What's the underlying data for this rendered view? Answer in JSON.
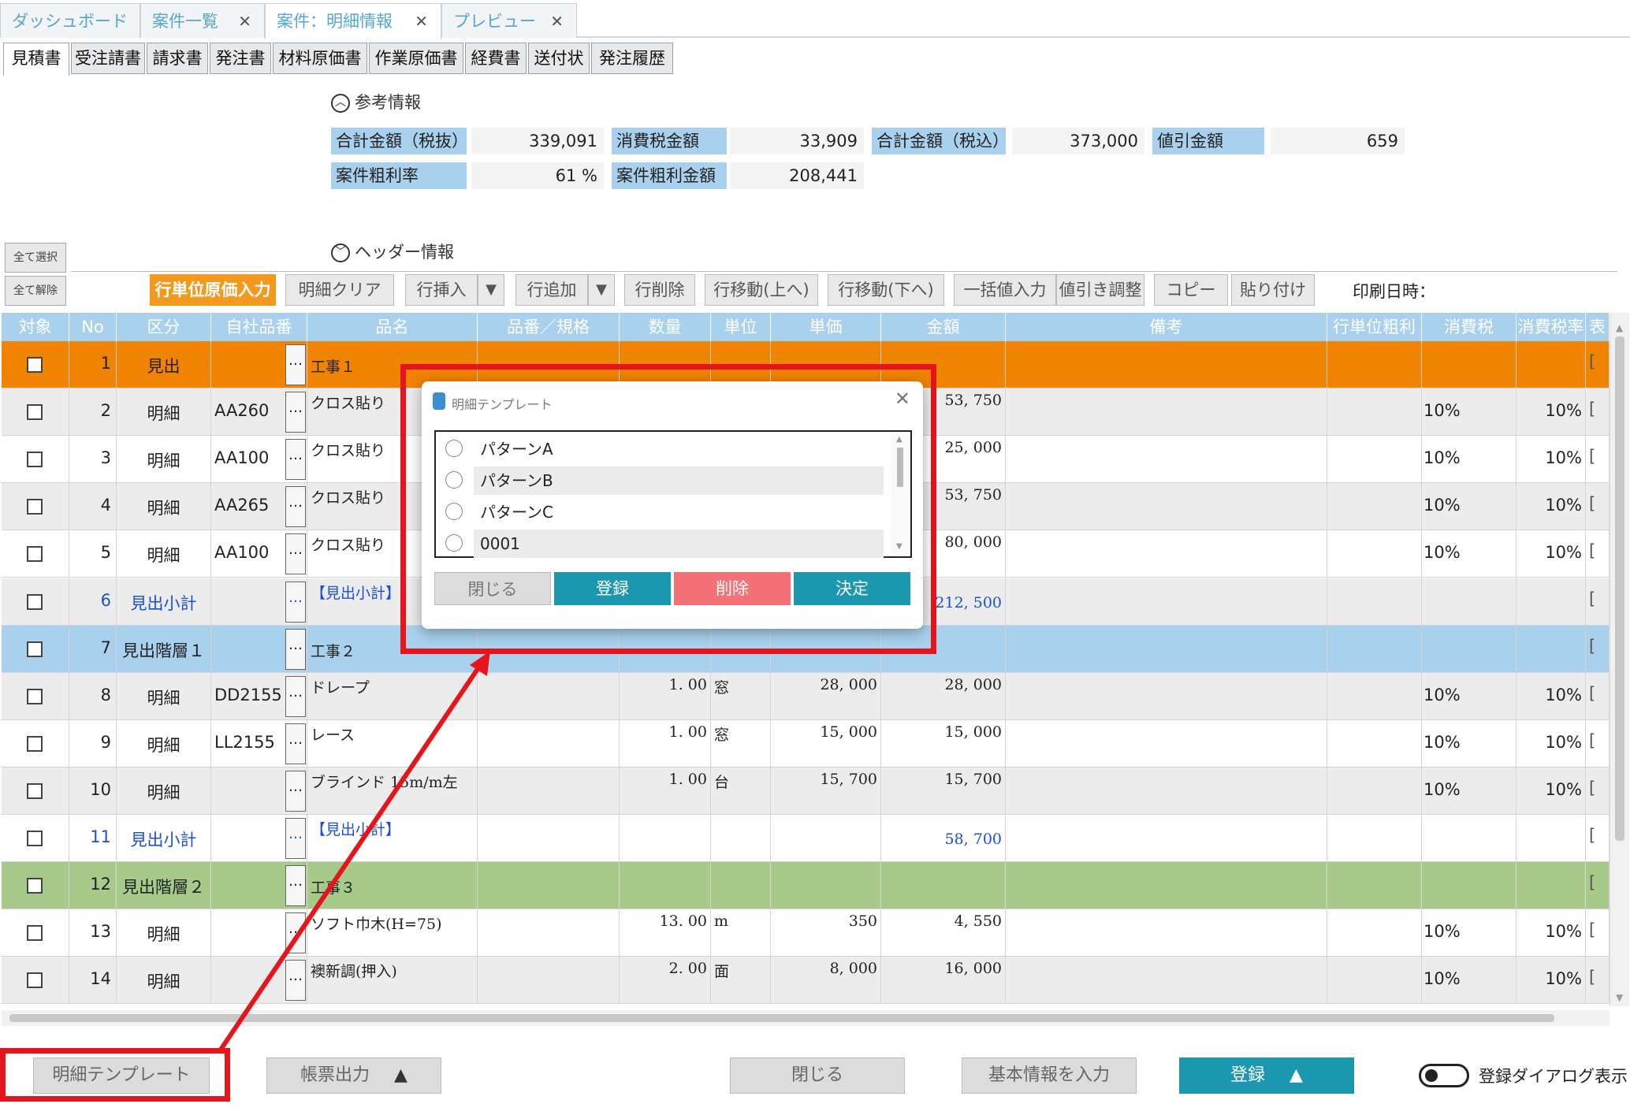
{
  "main_tabs": [
    {
      "label": "ダッシュボード",
      "closable": false
    },
    {
      "label": "案件一覧",
      "closable": true
    },
    {
      "label": "案件：明細情報",
      "closable": true
    },
    {
      "label": "プレビュー",
      "closable": true
    }
  ],
  "close_glyph": "✕",
  "doc_tabs": [
    "見積書",
    "受注請書",
    "請求書",
    "発注書",
    "材料原価書",
    "作業原価書",
    "経費書",
    "送付状",
    "発注履歴"
  ],
  "reference": {
    "title": "参考情報",
    "labels": [
      "合計金額（税抜）",
      "消費税金額",
      "合計金額（税込）",
      "値引金額",
      "案件粗利率",
      "案件粗利金額"
    ],
    "values": [
      "339,091",
      "33,909",
      "373,000",
      "659",
      "61 %",
      "208,441"
    ]
  },
  "header_section": {
    "title": "ヘッダー情報"
  },
  "side_buttons": {
    "select_all": "全て選択",
    "deselect_all": "全て解除"
  },
  "toolbar": {
    "cost_input": "行単位原価入力",
    "clear": "明細クリア",
    "insert": "行挿入",
    "add": "行追加",
    "delete": "行削除",
    "move_up": "行移動(上へ)",
    "move_down": "行移動(下へ)",
    "bulk": "一括値入力",
    "discount": "値引き調整",
    "copy": "コピー",
    "paste": "貼り付け",
    "print_date": "印刷日時："
  },
  "grid": {
    "columns": [
      "対象",
      "No",
      "区分",
      "自社品番",
      "品名",
      "品番／規格",
      "数量",
      "単位",
      "単価",
      "金額",
      "備考",
      "行単位粗利",
      "消費税",
      "消費税率",
      "表"
    ],
    "rows": [
      {
        "no": "1",
        "kubun": "見出",
        "code": "",
        "name": "工事１",
        "qty": "",
        "unit": "",
        "price": "",
        "amount": "",
        "tax": "",
        "rate": "",
        "style": "orange"
      },
      {
        "no": "2",
        "kubun": "明細",
        "code": "AA260",
        "name": "クロス貼り",
        "qty": "",
        "unit": "",
        "price": "",
        "amount": "53, 750",
        "tax": "10%",
        "rate": "10%",
        "style": "grey"
      },
      {
        "no": "3",
        "kubun": "明細",
        "code": "AA100",
        "name": "クロス貼り",
        "qty": "",
        "unit": "",
        "price": "",
        "amount": "25, 000",
        "tax": "10%",
        "rate": "10%",
        "style": "white"
      },
      {
        "no": "4",
        "kubun": "明細",
        "code": "AA265",
        "name": "クロス貼り",
        "qty": "",
        "unit": "",
        "price": "",
        "amount": "53, 750",
        "tax": "10%",
        "rate": "10%",
        "style": "grey"
      },
      {
        "no": "5",
        "kubun": "明細",
        "code": "AA100",
        "name": "クロス貼り",
        "qty": "",
        "unit": "",
        "price": "",
        "amount": "80, 000",
        "tax": "10%",
        "rate": "10%",
        "style": "white"
      },
      {
        "no": "6",
        "kubun": "見出小計",
        "code": "",
        "name": "【見出小計】",
        "qty": "",
        "unit": "",
        "price": "",
        "amount": "212, 500",
        "tax": "",
        "rate": "",
        "style": "grey",
        "link": true
      },
      {
        "no": "7",
        "kubun": "見出階層１",
        "code": "",
        "name": "工事２",
        "qty": "",
        "unit": "",
        "price": "",
        "amount": "",
        "tax": "",
        "rate": "",
        "style": "blue"
      },
      {
        "no": "8",
        "kubun": "明細",
        "code": "DD2155",
        "name": "ドレープ",
        "qty": "1. 00",
        "unit": "窓",
        "price": "28, 000",
        "amount": "28, 000",
        "tax": "10%",
        "rate": "10%",
        "style": "grey"
      },
      {
        "no": "9",
        "kubun": "明細",
        "code": "LL2155",
        "name": "レース",
        "qty": "1. 00",
        "unit": "窓",
        "price": "15, 000",
        "amount": "15, 000",
        "tax": "10%",
        "rate": "10%",
        "style": "white"
      },
      {
        "no": "10",
        "kubun": "明細",
        "code": "",
        "name": "ブラインド 15m/m左",
        "qty": "1. 00",
        "unit": "台",
        "price": "15, 700",
        "amount": "15, 700",
        "tax": "10%",
        "rate": "10%",
        "style": "grey"
      },
      {
        "no": "11",
        "kubun": "見出小計",
        "code": "",
        "name": "【見出小計】",
        "qty": "",
        "unit": "",
        "price": "",
        "amount": "58, 700",
        "tax": "",
        "rate": "",
        "style": "white",
        "link": true
      },
      {
        "no": "12",
        "kubun": "見出階層２",
        "code": "",
        "name": "工事３",
        "qty": "",
        "unit": "",
        "price": "",
        "amount": "",
        "tax": "",
        "rate": "",
        "style": "green"
      },
      {
        "no": "13",
        "kubun": "明細",
        "code": "",
        "name": "ソフト巾木(H=75)",
        "qty": "13. 00",
        "unit": "m",
        "price": "350",
        "amount": "4, 550",
        "tax": "10%",
        "rate": "10%",
        "style": "white"
      },
      {
        "no": "14",
        "kubun": "明細",
        "code": "",
        "name": "襖新調(押入)",
        "qty": "2. 00",
        "unit": "面",
        "price": "8, 000",
        "amount": "16, 000",
        "tax": "10%",
        "rate": "10%",
        "style": "grey"
      }
    ]
  },
  "bottom": {
    "template": "明細テンプレート",
    "report": "帳票出力",
    "close": "閉じる",
    "basic": "基本情報を入力",
    "register": "登録",
    "toggle_label": "登録ダイアログ表示"
  },
  "dialog": {
    "title": "明細テンプレート",
    "options": [
      "パターンA",
      "パターンB",
      "パターンC",
      "0001"
    ],
    "close": "閉じる",
    "register": "登録",
    "delete": "削除",
    "decide": "決定"
  },
  "colors": {
    "accent": "#f39a1e",
    "primary": "#1b98b0",
    "header_blue": "#a9d1ee",
    "highlight": "#e6141b",
    "delete": "#f47277"
  }
}
